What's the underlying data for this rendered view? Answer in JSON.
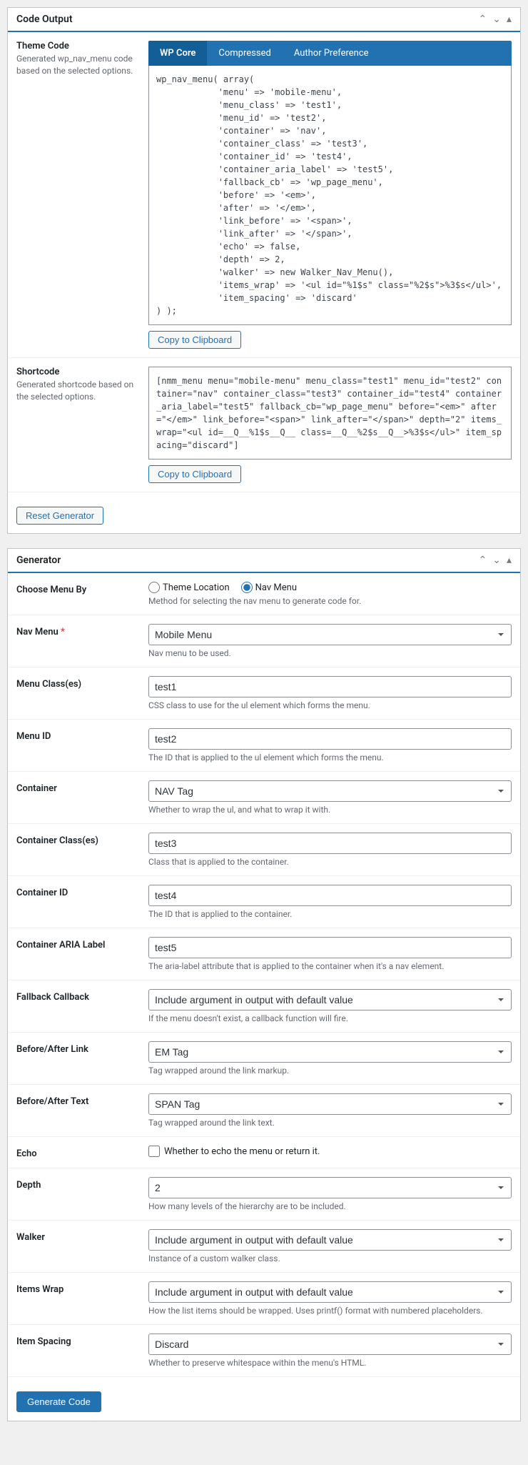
{
  "codeOutput": {
    "title": "Code Output",
    "themeCode": {
      "label": "Theme Code",
      "desc": "Generated wp_nav_menu code based on the selected options.",
      "tabs": {
        "wpcore": "WP Core",
        "compressed": "Compressed",
        "author": "Author Preference"
      },
      "code": "wp_nav_menu( array(\n            'menu' => 'mobile-menu',\n            'menu_class' => 'test1',\n            'menu_id' => 'test2',\n            'container' => 'nav',\n            'container_class' => 'test3',\n            'container_id' => 'test4',\n            'container_aria_label' => 'test5',\n            'fallback_cb' => 'wp_page_menu',\n            'before' => '<em>',\n            'after' => '</em>',\n            'link_before' => '<span>',\n            'link_after' => '</span>',\n            'echo' => false,\n            'depth' => 2,\n            'walker' => new Walker_Nav_Menu(),\n            'items_wrap' => '<ul id=\"%1$s\" class=\"%2$s\">%3$s</ul>',\n            'item_spacing' => 'discard'\n) );",
      "copyBtn": "Copy to Clipboard"
    },
    "shortcode": {
      "label": "Shortcode",
      "desc": "Generated shortcode based on the selected options.",
      "code": "[nmm_menu menu=\"mobile-menu\" menu_class=\"test1\" menu_id=\"test2\" container=\"nav\" container_class=\"test3\" container_id=\"test4\" container_aria_label=\"test5\" fallback_cb=\"wp_page_menu\" before=\"<em>\" after=\"</em>\" link_before=\"<span>\" link_after=\"</span>\" depth=\"2\" items_wrap=\"<ul id=__Q__%1$s__Q__ class=__Q__%2$s__Q__>%3$s</ul>\" item_spacing=\"discard\"]",
      "copyBtn": "Copy to Clipboard"
    },
    "resetBtn": "Reset Generator"
  },
  "generator": {
    "title": "Generator",
    "chooseMenuBy": {
      "label": "Choose Menu By",
      "opt1": "Theme Location",
      "opt2": "Nav Menu",
      "help": "Method for selecting the nav menu to generate code for."
    },
    "navMenu": {
      "label": "Nav Menu",
      "value": "Mobile Menu",
      "help": "Nav menu to be used."
    },
    "menuClass": {
      "label": "Menu Class(es)",
      "value": "test1",
      "help": "CSS class to use for the ul element which forms the menu."
    },
    "menuId": {
      "label": "Menu ID",
      "value": "test2",
      "help": "The ID that is applied to the ul element which forms the menu."
    },
    "container": {
      "label": "Container",
      "value": "NAV Tag",
      "help": "Whether to wrap the ul, and what to wrap it with."
    },
    "containerClass": {
      "label": "Container Class(es)",
      "value": "test3",
      "help": "Class that is applied to the container."
    },
    "containerId": {
      "label": "Container ID",
      "value": "test4",
      "help": "The ID that is applied to the container."
    },
    "containerAria": {
      "label": "Container ARIA Label",
      "value": "test5",
      "help": "The aria-label attribute that is applied to the container when it's a nav element."
    },
    "fallback": {
      "label": "Fallback Callback",
      "value": "Include argument in output with default value",
      "help": "If the menu doesn't exist, a callback function will fire."
    },
    "beforeAfterLink": {
      "label": "Before/After Link",
      "value": "EM Tag",
      "help": "Tag wrapped around the link markup."
    },
    "beforeAfterText": {
      "label": "Before/After Text",
      "value": "SPAN Tag",
      "help": "Tag wrapped around the link text."
    },
    "echo": {
      "label": "Echo",
      "checkLabel": "Whether to echo the menu or return it."
    },
    "depth": {
      "label": "Depth",
      "value": "2",
      "help": "How many levels of the hierarchy are to be included."
    },
    "walker": {
      "label": "Walker",
      "value": "Include argument in output with default value",
      "help": "Instance of a custom walker class."
    },
    "itemsWrap": {
      "label": "Items Wrap",
      "value": "Include argument in output with default value",
      "help": "How the list items should be wrapped. Uses printf() format with numbered placeholders."
    },
    "itemSpacing": {
      "label": "Item Spacing",
      "value": "Discard",
      "help": "Whether to preserve whitespace within the menu's HTML."
    },
    "generateBtn": "Generate Code"
  }
}
